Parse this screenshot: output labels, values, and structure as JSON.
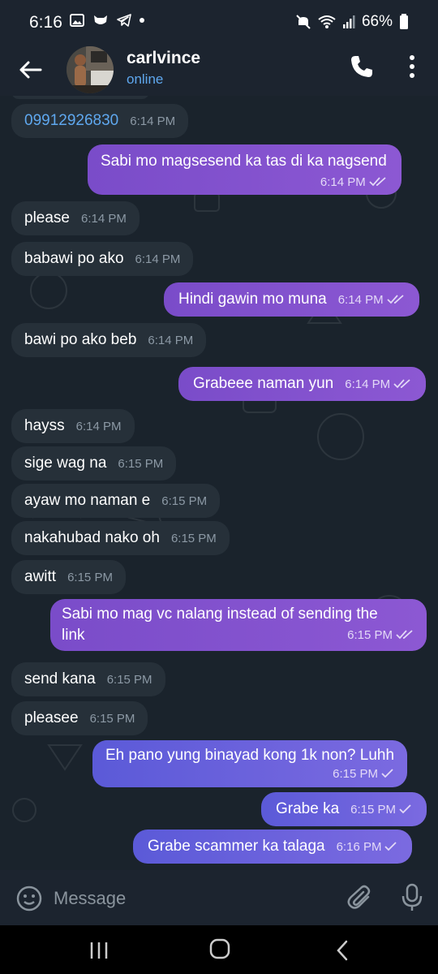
{
  "status_bar": {
    "time": "6:16",
    "battery": "66%"
  },
  "header": {
    "name": "carlvince",
    "status": "online"
  },
  "messages": [
    {
      "dir": "in",
      "text": "09912926830",
      "time": "6:14 PM",
      "link": true
    },
    {
      "dir": "out",
      "text": "Sabi mo magsesend ka tas di ka nagsend",
      "time": "6:14 PM",
      "read": "double"
    },
    {
      "dir": "in",
      "text": "please",
      "time": "6:14 PM"
    },
    {
      "dir": "in",
      "text": "babawi po ako",
      "time": "6:14 PM"
    },
    {
      "dir": "out",
      "text": "Hindi gawin mo muna",
      "time": "6:14 PM",
      "read": "double"
    },
    {
      "dir": "in",
      "text": "bawi po ako beb",
      "time": "6:14 PM"
    },
    {
      "dir": "out",
      "text": "Grabeee naman yun",
      "time": "6:14 PM",
      "read": "double"
    },
    {
      "dir": "in",
      "text": "hayss",
      "time": "6:14 PM"
    },
    {
      "dir": "in",
      "text": "sige wag na",
      "time": "6:15 PM"
    },
    {
      "dir": "in",
      "text": "ayaw mo naman e",
      "time": "6:15 PM"
    },
    {
      "dir": "in",
      "text": "nakahubad nako oh",
      "time": "6:15 PM"
    },
    {
      "dir": "in",
      "text": "awitt",
      "time": "6:15 PM"
    },
    {
      "dir": "out",
      "text": "Sabi mo mag vc nalang instead of sending the",
      "text2": "link",
      "time": "6:15 PM",
      "read": "double"
    },
    {
      "dir": "in",
      "text": "send kana",
      "time": "6:15 PM"
    },
    {
      "dir": "in",
      "text": "pleasee",
      "time": "6:15 PM"
    },
    {
      "dir": "out",
      "text": "Eh pano yung binayad kong 1k non? Luhh",
      "time": "6:15 PM",
      "read": "single"
    },
    {
      "dir": "out",
      "text": "Grabe ka",
      "time": "6:15 PM",
      "read": "single"
    },
    {
      "dir": "out",
      "text": "Grabe scammer ka talaga",
      "time": "6:16 PM",
      "read": "single"
    }
  ],
  "input": {
    "placeholder": "Message"
  },
  "colors": {
    "outgoing": "#8654cf",
    "incoming": "#263039",
    "accent": "#5fa8ef"
  }
}
